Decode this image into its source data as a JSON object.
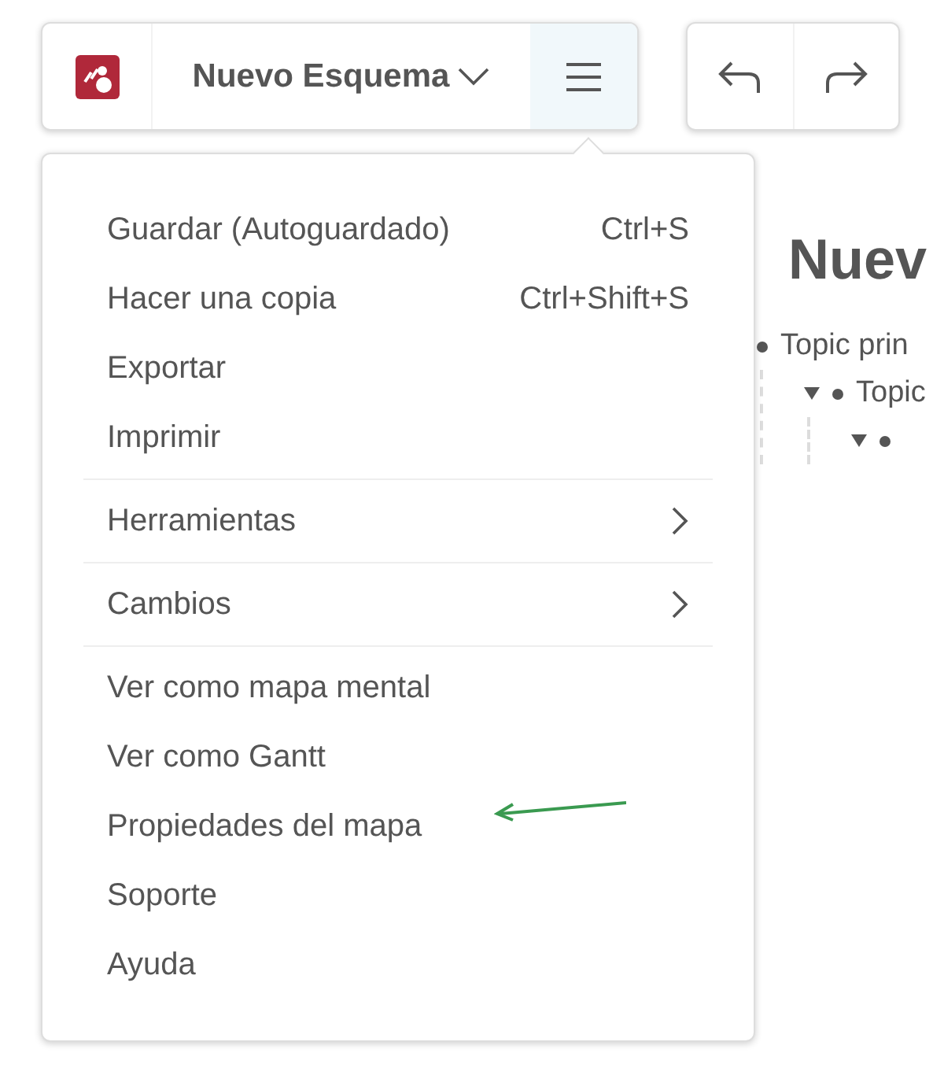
{
  "toolbar": {
    "title": "Nuevo Esquema",
    "menu_open": true
  },
  "menu": {
    "groups": [
      {
        "items": [
          {
            "kind": "action",
            "label": "Guardar (Autoguardado)",
            "shortcut": "Ctrl+S"
          },
          {
            "kind": "action",
            "label": "Hacer una copia",
            "shortcut": "Ctrl+Shift+S"
          },
          {
            "kind": "action",
            "label": "Exportar"
          },
          {
            "kind": "action",
            "label": "Imprimir"
          }
        ]
      },
      {
        "items": [
          {
            "kind": "submenu",
            "label": "Herramientas"
          }
        ]
      },
      {
        "items": [
          {
            "kind": "submenu",
            "label": "Cambios"
          }
        ]
      },
      {
        "items": [
          {
            "kind": "action",
            "label": "Ver como mapa mental"
          },
          {
            "kind": "action",
            "label": "Ver como Gantt"
          },
          {
            "kind": "action",
            "label": "Propiedades del mapa"
          },
          {
            "kind": "action",
            "label": "Soporte"
          },
          {
            "kind": "action",
            "label": "Ayuda"
          }
        ]
      }
    ]
  },
  "outline": {
    "title": "Nuev",
    "topics": [
      {
        "label": "Topic prin",
        "children": [
          {
            "label": "Topic",
            "expanded": true,
            "children": [
              {
                "expanded": true
              }
            ]
          }
        ]
      }
    ]
  }
}
